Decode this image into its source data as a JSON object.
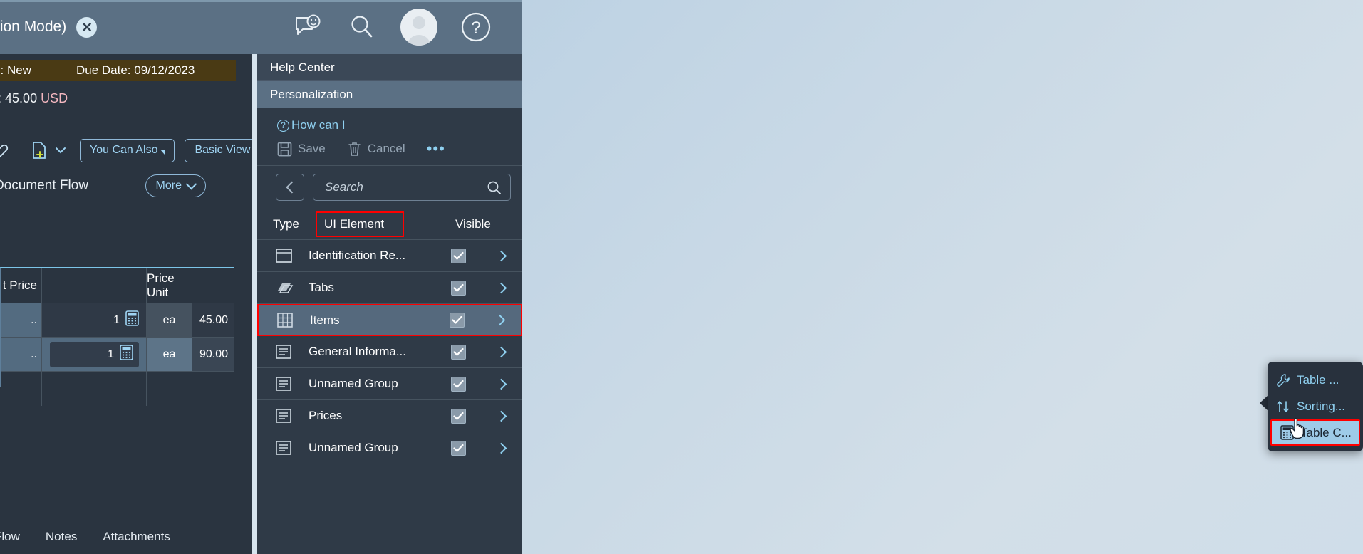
{
  "shell": {
    "title": "tion Mode)",
    "close_icon": "close-icon",
    "icons": [
      {
        "name": "feedback-icon",
        "label": "Feedback"
      },
      {
        "name": "search-icon",
        "label": "Search"
      },
      {
        "name": "avatar-icon",
        "label": "User"
      },
      {
        "name": "help-icon",
        "label": "Help"
      }
    ]
  },
  "left": {
    "status_label": "s: New",
    "due_date": "Due Date: 09/12/2023",
    "amount_prefix": "t:",
    "amount_value": "45.00",
    "amount_currency": "USD",
    "toolbar": {
      "tag_icon": "tag-icon",
      "new_doc_icon": "new-document-icon",
      "dropdown_icon": "chevron-down-icon",
      "you_can_also": "You Can Also",
      "basic_view": "Basic View"
    },
    "section_title": "Document Flow",
    "more_button": "More",
    "table": {
      "headers": [
        "t Price",
        "",
        "Price Unit",
        ""
      ],
      "rows": [
        {
          "price": "..",
          "qty": "1",
          "calc_icon": "calculator-icon",
          "unit": "ea",
          "amount": "45.00"
        },
        {
          "price": "..",
          "qty": "1",
          "calc_icon": "calculator-icon",
          "unit": "ea",
          "amount": "90.00"
        },
        {
          "price": "",
          "qty": "",
          "calc_icon": "",
          "unit": "",
          "amount": ""
        }
      ]
    },
    "bottom_tabs": [
      "Flow",
      "Notes",
      "Attachments"
    ]
  },
  "panel": {
    "title": "Help Center",
    "subtitle": "Personalization",
    "how_can_i": "How can I",
    "save_label": "Save",
    "cancel_label": "Cancel",
    "overflow_label": "•••",
    "back_icon": "chevron-left-icon",
    "search_placeholder": "Search",
    "search_icon": "search-icon",
    "columns": {
      "type": "Type",
      "ui_element": "UI Element",
      "visible": "Visible"
    },
    "highlight_color": "#ff0000",
    "items": [
      {
        "icon": "panel-icon",
        "label": "Identification Re...",
        "visible": true,
        "selected": false,
        "highlighted": false
      },
      {
        "icon": "tabs-icon",
        "label": "Tabs",
        "visible": true,
        "selected": false,
        "highlighted": false
      },
      {
        "icon": "table-icon",
        "label": "Items",
        "visible": true,
        "selected": true,
        "highlighted": true
      },
      {
        "icon": "form-icon",
        "label": "General Informa...",
        "visible": true,
        "selected": false,
        "highlighted": false
      },
      {
        "icon": "form-icon",
        "label": "Unnamed Group",
        "visible": true,
        "selected": false,
        "highlighted": false
      },
      {
        "icon": "form-icon",
        "label": "Prices",
        "visible": true,
        "selected": false,
        "highlighted": false
      },
      {
        "icon": "form-icon",
        "label": "Unnamed Group",
        "visible": true,
        "selected": false,
        "highlighted": false
      }
    ]
  },
  "popup": {
    "items": [
      {
        "icon": "wrench-icon",
        "label": "Table ...",
        "highlighted": false
      },
      {
        "icon": "sort-icon",
        "label": "Sorting...",
        "highlighted": false
      },
      {
        "icon": "calculator-icon",
        "label": "Table C...",
        "highlighted": true
      }
    ]
  }
}
